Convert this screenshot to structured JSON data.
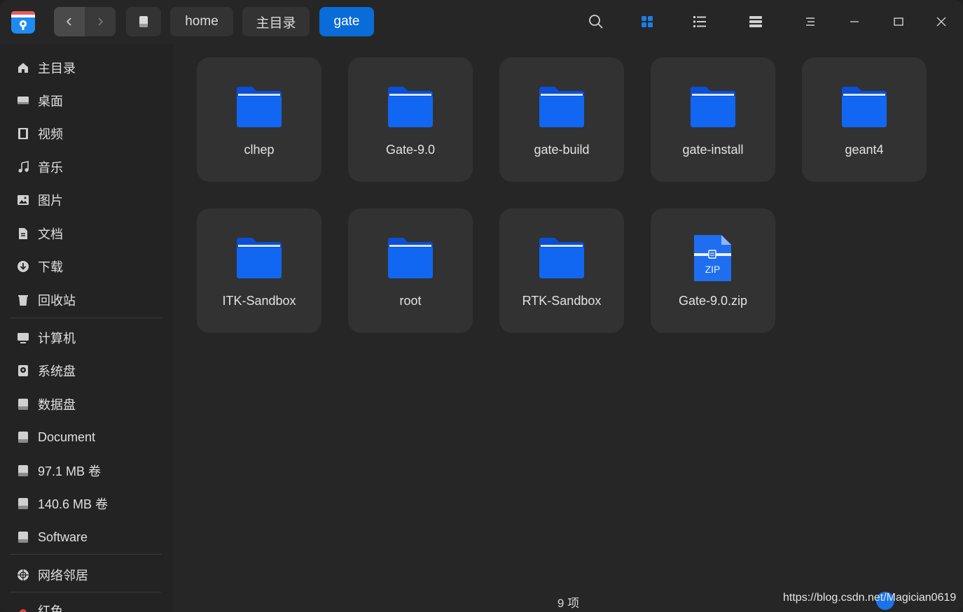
{
  "titlebar": {
    "breadcrumbs": [
      {
        "label": "",
        "icon": "drive-icon"
      },
      {
        "label": "home"
      },
      {
        "label": "主目录"
      },
      {
        "label": "gate",
        "active": true
      }
    ],
    "accent": "#0a6cd8",
    "tools": [
      "search-icon",
      "icon-view-icon",
      "list-view-icon",
      "detail-view-icon",
      "menu-icon",
      "minimize-icon",
      "maximize-icon",
      "close-icon"
    ]
  },
  "sidebar": {
    "items": [
      {
        "label": "主目录",
        "icon": "home-icon"
      },
      {
        "label": "桌面",
        "icon": "desktop-icon"
      },
      {
        "label": "视频",
        "icon": "video-icon"
      },
      {
        "label": "音乐",
        "icon": "music-icon"
      },
      {
        "label": "图片",
        "icon": "picture-icon"
      },
      {
        "label": "文档",
        "icon": "document-icon"
      },
      {
        "label": "下载",
        "icon": "download-icon"
      },
      {
        "label": "回收站",
        "icon": "trash-icon"
      },
      {
        "label": "计算机",
        "icon": "computer-icon"
      },
      {
        "label": "系统盘",
        "icon": "system-disk-icon"
      },
      {
        "label": "数据盘",
        "icon": "disk-icon"
      },
      {
        "label": "Document",
        "icon": "disk-icon"
      },
      {
        "label": "97.1 MB 卷",
        "icon": "disk-icon"
      },
      {
        "label": "140.6 MB 卷",
        "icon": "disk-icon"
      },
      {
        "label": "Software",
        "icon": "disk-icon"
      },
      {
        "label": "网络邻居",
        "icon": "network-icon"
      },
      {
        "label": "红色",
        "icon": "red-tag-icon"
      }
    ]
  },
  "files": [
    {
      "name": "clhep",
      "type": "folder"
    },
    {
      "name": "Gate-9.0",
      "type": "folder"
    },
    {
      "name": "gate-build",
      "type": "folder"
    },
    {
      "name": "gate-install",
      "type": "folder"
    },
    {
      "name": "geant4",
      "type": "folder"
    },
    {
      "name": "ITK-Sandbox",
      "type": "folder"
    },
    {
      "name": "root",
      "type": "folder"
    },
    {
      "name": "RTK-Sandbox",
      "type": "folder"
    },
    {
      "name": "Gate-9.0.zip",
      "type": "zip",
      "badge": "ZIP"
    }
  ],
  "status": {
    "count": "9 项"
  },
  "watermark": "https://blog.csdn.net/Magician0619"
}
